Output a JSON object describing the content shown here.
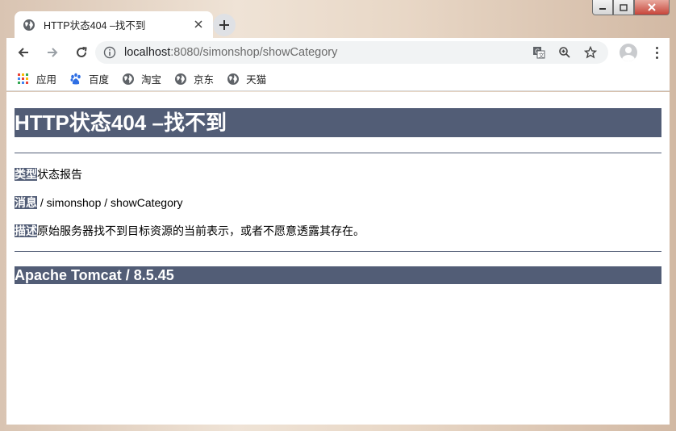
{
  "window": {
    "controls": {
      "minimize": "▭",
      "maximize": "□",
      "close": "✕"
    }
  },
  "tab": {
    "title": "HTTP状态404 –找不到",
    "icon": "globe-icon",
    "close": "✕"
  },
  "new_tab": "+",
  "address_bar": {
    "host": "localhost",
    "rest": ":8080/simonshop/showCategory"
  },
  "bookmarks": [
    {
      "label": "应用",
      "icon": "apps-grid-icon"
    },
    {
      "label": "百度",
      "icon": "baidu-paw-icon"
    },
    {
      "label": "淘宝",
      "icon": "globe-icon"
    },
    {
      "label": "京东",
      "icon": "globe-icon"
    },
    {
      "label": "天猫",
      "icon": "globe-icon"
    }
  ],
  "page": {
    "title": "HTTP状态404 –找不到",
    "type_label": "类型",
    "type_value": "状态报告",
    "message_label": "消息",
    "message_value": " / simonshop / showCategory",
    "description_label": "描述",
    "description_value": "原始服务器找不到目标资源的当前表示，或者不愿意透露其存在。",
    "server": "Apache Tomcat / 8.5.45"
  },
  "colors": {
    "tomcat_header": "#525d76",
    "chrome_toolbar": "#ffffff",
    "omnibox": "#f1f3f4"
  }
}
